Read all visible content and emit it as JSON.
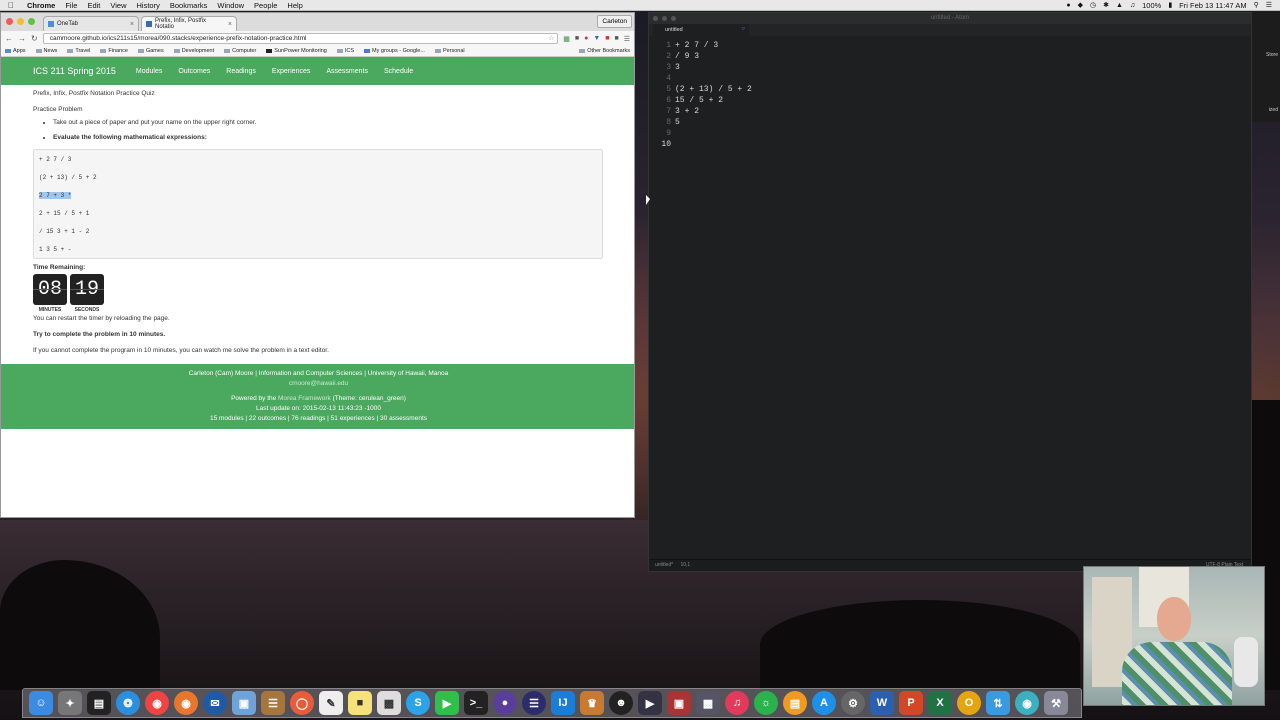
{
  "menubar": {
    "app_name": "Chrome",
    "items": [
      "File",
      "Edit",
      "View",
      "History",
      "Bookmarks",
      "Window",
      "People",
      "Help"
    ],
    "battery": "100%",
    "clock": "Fri Feb 13  11:47 AM"
  },
  "chrome": {
    "tabs": [
      {
        "title": "OneTab"
      },
      {
        "title": "Prefix, Infix, Postfix Notatio"
      }
    ],
    "profile": "Carleton",
    "url": "cammoore.github.io/ics211s15/morea/090.stacks/experience-prefix-notation-practice.html",
    "bookmarks": [
      "Apps",
      "News",
      "Travel",
      "Finance",
      "Games",
      "Development",
      "Computer",
      "SunPower Monitoring",
      "ICS",
      "My groups - Google...",
      "Personal"
    ],
    "other_bookmarks": "Other Bookmarks"
  },
  "site": {
    "brand": "ICS 211 Spring 2015",
    "nav": [
      "Modules",
      "Outcomes",
      "Readings",
      "Experiences",
      "Assessments",
      "Schedule"
    ],
    "breadcrumb": "Prefix, Infix, Postfix Notation Practice Quiz",
    "heading": "Practice Problem",
    "bullets": [
      "Take out a piece of paper and put your name on the upper right corner.",
      "Evaluate the following mathematical expressions:"
    ],
    "expressions": [
      "+ 2 7 / 3",
      "(2 + 13) / 5 + 2",
      "2 7 + 3 *",
      "2 + 15 / 5 + 1",
      "/ 15 3 + 1 - 2",
      "1 3 5 + -"
    ],
    "time_label": "Time Remaining:",
    "timer_minutes": "08",
    "timer_seconds": "19",
    "minutes_label": "MINUTES",
    "seconds_label": "SECONDS",
    "restart_note": "You can restart the timer by reloading the page.",
    "try_note": "Try to complete the problem in 10 minutes.",
    "fallback_note": "If you cannot complete the program in 10 minutes, you can watch me solve the problem in a text editor."
  },
  "footer": {
    "line1": "Carleton (Cam) Moore | Information and Computer Sciences | University of Hawaii, Manoa",
    "email": "cmoore@hawaii.edu",
    "powered_prefix": "Powered by the ",
    "powered_link": "Morea Framework",
    "powered_suffix": " (Theme: cerulean_green)",
    "last_update": "Last update on: 2015-02-13 11:43:23 -1000",
    "stats": "15 modules | 22 outcomes | 76 readings | 51 experiences | 30 assessments"
  },
  "atom": {
    "window_title": "untitled - Atom",
    "tab_title": "untitled",
    "line_numbers": [
      "1",
      "2",
      "3",
      "4",
      "5",
      "6",
      "7",
      "8",
      "9",
      "10"
    ],
    "lines": [
      "+ 2 7 / 3",
      "/ 9 3",
      "3",
      "",
      "(2 + 13) / 5 + 2",
      "15 / 5 + 2",
      "3 + 2",
      "5",
      "",
      ""
    ],
    "status_file": "untitled*",
    "status_pos": "10,1",
    "status_right": "UTF-8   Plain Text"
  },
  "right_window": {
    "labels": [
      "Store",
      "ized"
    ]
  },
  "dock": {
    "apps": [
      "Finder",
      "Launchpad",
      "Activity Monitor",
      "Safari",
      "Chrome",
      "Firefox",
      "Thunderbird",
      "Preview",
      "Notes",
      "Stickies",
      "TextEdit",
      "Skype",
      "Messages",
      "Terminal",
      "Eclipse",
      "IntelliJ",
      "Lightroom",
      "GitHub",
      "QuickTime",
      "Photo Booth",
      "Screenshot",
      "iTunes",
      "Spotify",
      "iBooks",
      "App Store",
      "System Preferences",
      "Word",
      "PowerPoint",
      "Excel",
      "Outlook",
      "Sync",
      "Network",
      "Utilities"
    ]
  }
}
